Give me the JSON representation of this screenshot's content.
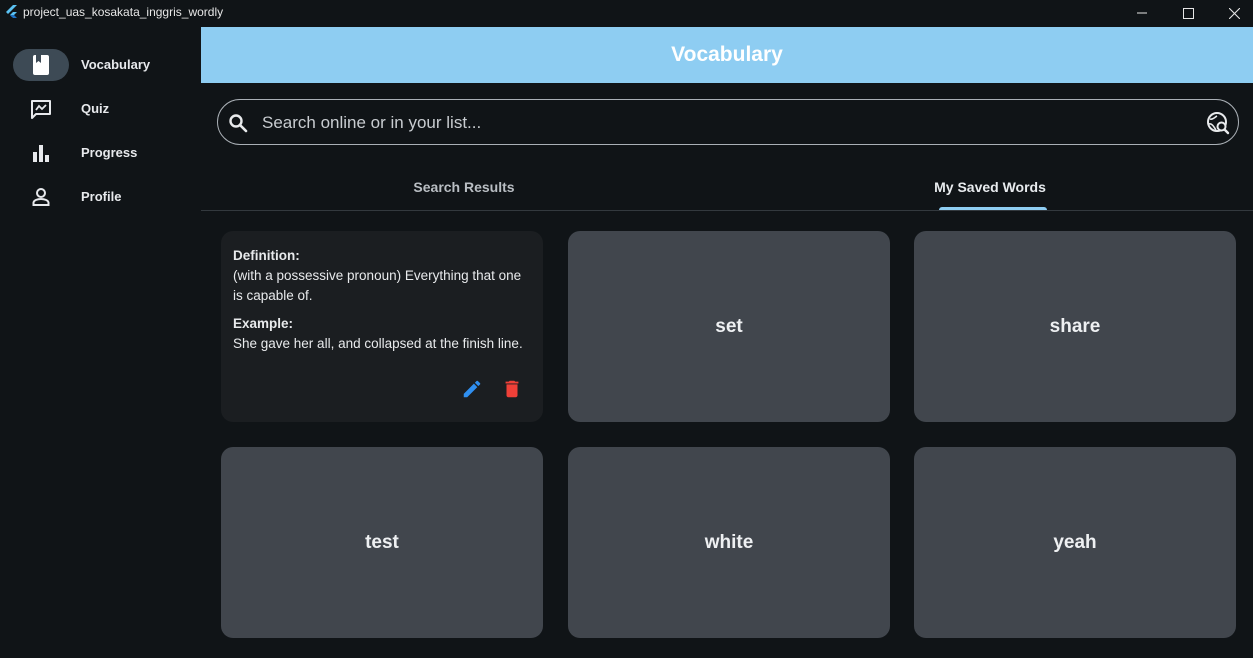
{
  "window": {
    "title": "project_uas_kosakata_inggris_wordly",
    "controls": [
      "minimize-icon",
      "maximize-icon",
      "close-icon"
    ]
  },
  "sidebar": {
    "items": [
      {
        "label": "Vocabulary",
        "icon": "book-icon",
        "active": true
      },
      {
        "label": "Quiz",
        "icon": "quiz-icon",
        "active": false
      },
      {
        "label": "Progress",
        "icon": "bar-chart-icon",
        "active": false
      },
      {
        "label": "Profile",
        "icon": "person-icon",
        "active": false
      }
    ]
  },
  "appbar": {
    "title": "Vocabulary"
  },
  "search": {
    "placeholder": "Search online or in your list...",
    "value": "",
    "left_icon": "search-icon",
    "right_icon": "travel-explore-icon"
  },
  "tabs": [
    {
      "label": "Search Results",
      "active": false
    },
    {
      "label": "My Saved Words",
      "active": true
    }
  ],
  "cards": [
    {
      "flipped": true,
      "definition_label": "Definition:",
      "definition": "(with a possessive pronoun) Everything that one is capable of.",
      "example_label": "Example:",
      "example": "She gave her all, and collapsed at the finish line.",
      "actions": [
        "edit-icon",
        "delete-icon"
      ]
    },
    {
      "word": "set"
    },
    {
      "word": "share"
    },
    {
      "word": "test"
    },
    {
      "word": "white"
    },
    {
      "word": "yeah"
    }
  ],
  "colors": {
    "accent": "#8ecdf2",
    "background": "#101417",
    "card": "#41464d",
    "card_flipped": "#1b1e21",
    "edit": "#2f8ff0",
    "delete": "#ef4038"
  }
}
